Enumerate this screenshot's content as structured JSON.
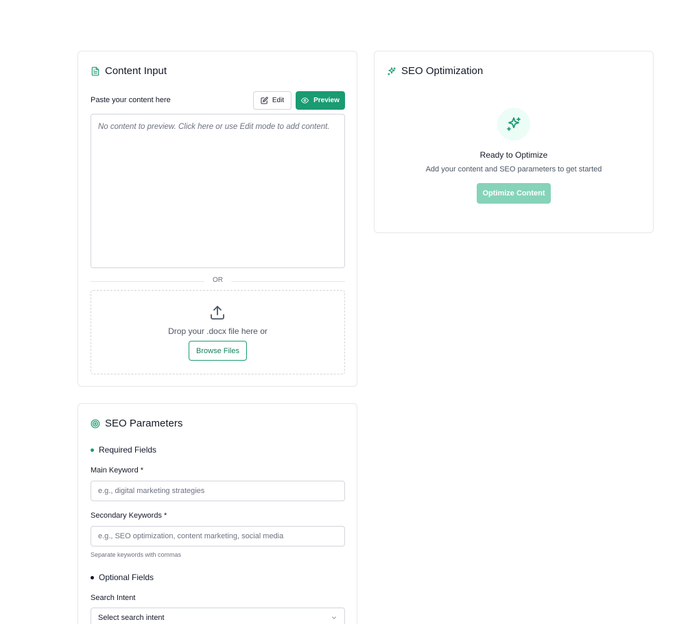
{
  "content_input": {
    "title": "Content Input",
    "paste_label": "Paste your content here",
    "edit_label": "Edit",
    "preview_label": "Preview",
    "preview_placeholder": "No content to preview. Click here or use Edit mode to add content.",
    "or_text": "OR",
    "drop_text": "Drop your .docx file here or",
    "browse_label": "Browse Files"
  },
  "seo_optimization": {
    "title": "SEO Optimization",
    "ready_title": "Ready to Optimize",
    "ready_subtitle": "Add your content and SEO parameters to get started",
    "optimize_label": "Optimize Content"
  },
  "seo_parameters": {
    "title": "SEO Parameters",
    "required_heading": "Required Fields",
    "main_keyword_label": "Main Keyword *",
    "main_keyword_placeholder": "e.g., digital marketing strategies",
    "main_keyword_value": "",
    "secondary_keywords_label": "Secondary Keywords *",
    "secondary_keywords_placeholder": "e.g., SEO optimization, content marketing, social media",
    "secondary_keywords_value": "",
    "secondary_help": "Separate keywords with commas",
    "optional_heading": "Optional Fields",
    "search_intent_label": "Search Intent",
    "search_intent_selected": "Select search intent"
  },
  "colors": {
    "accent": "#1a9b72",
    "accent_disabled": "#86d3b9",
    "border": "#e5e7eb"
  },
  "icons": {
    "content_input": "document-icon",
    "seo_optimization": "sparkles-icon",
    "seo_parameters": "target-icon",
    "edit": "pencil-square-icon",
    "preview": "eye-icon",
    "upload": "upload-icon",
    "select": "chevron-down-icon"
  }
}
